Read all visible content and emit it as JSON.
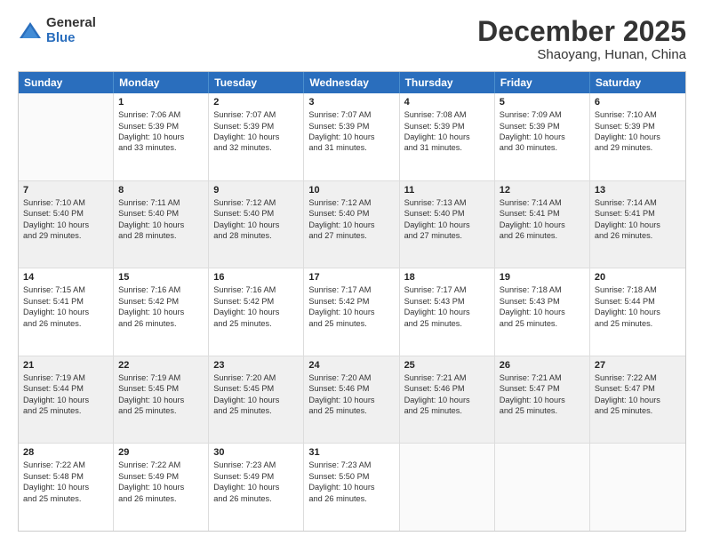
{
  "logo": {
    "general": "General",
    "blue": "Blue"
  },
  "header": {
    "month": "December 2025",
    "location": "Shaoyang, Hunan, China"
  },
  "days": [
    "Sunday",
    "Monday",
    "Tuesday",
    "Wednesday",
    "Thursday",
    "Friday",
    "Saturday"
  ],
  "rows": [
    [
      {
        "num": "",
        "lines": []
      },
      {
        "num": "1",
        "lines": [
          "Sunrise: 7:06 AM",
          "Sunset: 5:39 PM",
          "Daylight: 10 hours",
          "and 33 minutes."
        ]
      },
      {
        "num": "2",
        "lines": [
          "Sunrise: 7:07 AM",
          "Sunset: 5:39 PM",
          "Daylight: 10 hours",
          "and 32 minutes."
        ]
      },
      {
        "num": "3",
        "lines": [
          "Sunrise: 7:07 AM",
          "Sunset: 5:39 PM",
          "Daylight: 10 hours",
          "and 31 minutes."
        ]
      },
      {
        "num": "4",
        "lines": [
          "Sunrise: 7:08 AM",
          "Sunset: 5:39 PM",
          "Daylight: 10 hours",
          "and 31 minutes."
        ]
      },
      {
        "num": "5",
        "lines": [
          "Sunrise: 7:09 AM",
          "Sunset: 5:39 PM",
          "Daylight: 10 hours",
          "and 30 minutes."
        ]
      },
      {
        "num": "6",
        "lines": [
          "Sunrise: 7:10 AM",
          "Sunset: 5:39 PM",
          "Daylight: 10 hours",
          "and 29 minutes."
        ]
      }
    ],
    [
      {
        "num": "7",
        "lines": [
          "Sunrise: 7:10 AM",
          "Sunset: 5:40 PM",
          "Daylight: 10 hours",
          "and 29 minutes."
        ]
      },
      {
        "num": "8",
        "lines": [
          "Sunrise: 7:11 AM",
          "Sunset: 5:40 PM",
          "Daylight: 10 hours",
          "and 28 minutes."
        ]
      },
      {
        "num": "9",
        "lines": [
          "Sunrise: 7:12 AM",
          "Sunset: 5:40 PM",
          "Daylight: 10 hours",
          "and 28 minutes."
        ]
      },
      {
        "num": "10",
        "lines": [
          "Sunrise: 7:12 AM",
          "Sunset: 5:40 PM",
          "Daylight: 10 hours",
          "and 27 minutes."
        ]
      },
      {
        "num": "11",
        "lines": [
          "Sunrise: 7:13 AM",
          "Sunset: 5:40 PM",
          "Daylight: 10 hours",
          "and 27 minutes."
        ]
      },
      {
        "num": "12",
        "lines": [
          "Sunrise: 7:14 AM",
          "Sunset: 5:41 PM",
          "Daylight: 10 hours",
          "and 26 minutes."
        ]
      },
      {
        "num": "13",
        "lines": [
          "Sunrise: 7:14 AM",
          "Sunset: 5:41 PM",
          "Daylight: 10 hours",
          "and 26 minutes."
        ]
      }
    ],
    [
      {
        "num": "14",
        "lines": [
          "Sunrise: 7:15 AM",
          "Sunset: 5:41 PM",
          "Daylight: 10 hours",
          "and 26 minutes."
        ]
      },
      {
        "num": "15",
        "lines": [
          "Sunrise: 7:16 AM",
          "Sunset: 5:42 PM",
          "Daylight: 10 hours",
          "and 26 minutes."
        ]
      },
      {
        "num": "16",
        "lines": [
          "Sunrise: 7:16 AM",
          "Sunset: 5:42 PM",
          "Daylight: 10 hours",
          "and 25 minutes."
        ]
      },
      {
        "num": "17",
        "lines": [
          "Sunrise: 7:17 AM",
          "Sunset: 5:42 PM",
          "Daylight: 10 hours",
          "and 25 minutes."
        ]
      },
      {
        "num": "18",
        "lines": [
          "Sunrise: 7:17 AM",
          "Sunset: 5:43 PM",
          "Daylight: 10 hours",
          "and 25 minutes."
        ]
      },
      {
        "num": "19",
        "lines": [
          "Sunrise: 7:18 AM",
          "Sunset: 5:43 PM",
          "Daylight: 10 hours",
          "and 25 minutes."
        ]
      },
      {
        "num": "20",
        "lines": [
          "Sunrise: 7:18 AM",
          "Sunset: 5:44 PM",
          "Daylight: 10 hours",
          "and 25 minutes."
        ]
      }
    ],
    [
      {
        "num": "21",
        "lines": [
          "Sunrise: 7:19 AM",
          "Sunset: 5:44 PM",
          "Daylight: 10 hours",
          "and 25 minutes."
        ]
      },
      {
        "num": "22",
        "lines": [
          "Sunrise: 7:19 AM",
          "Sunset: 5:45 PM",
          "Daylight: 10 hours",
          "and 25 minutes."
        ]
      },
      {
        "num": "23",
        "lines": [
          "Sunrise: 7:20 AM",
          "Sunset: 5:45 PM",
          "Daylight: 10 hours",
          "and 25 minutes."
        ]
      },
      {
        "num": "24",
        "lines": [
          "Sunrise: 7:20 AM",
          "Sunset: 5:46 PM",
          "Daylight: 10 hours",
          "and 25 minutes."
        ]
      },
      {
        "num": "25",
        "lines": [
          "Sunrise: 7:21 AM",
          "Sunset: 5:46 PM",
          "Daylight: 10 hours",
          "and 25 minutes."
        ]
      },
      {
        "num": "26",
        "lines": [
          "Sunrise: 7:21 AM",
          "Sunset: 5:47 PM",
          "Daylight: 10 hours",
          "and 25 minutes."
        ]
      },
      {
        "num": "27",
        "lines": [
          "Sunrise: 7:22 AM",
          "Sunset: 5:47 PM",
          "Daylight: 10 hours",
          "and 25 minutes."
        ]
      }
    ],
    [
      {
        "num": "28",
        "lines": [
          "Sunrise: 7:22 AM",
          "Sunset: 5:48 PM",
          "Daylight: 10 hours",
          "and 25 minutes."
        ]
      },
      {
        "num": "29",
        "lines": [
          "Sunrise: 7:22 AM",
          "Sunset: 5:49 PM",
          "Daylight: 10 hours",
          "and 26 minutes."
        ]
      },
      {
        "num": "30",
        "lines": [
          "Sunrise: 7:23 AM",
          "Sunset: 5:49 PM",
          "Daylight: 10 hours",
          "and 26 minutes."
        ]
      },
      {
        "num": "31",
        "lines": [
          "Sunrise: 7:23 AM",
          "Sunset: 5:50 PM",
          "Daylight: 10 hours",
          "and 26 minutes."
        ]
      },
      {
        "num": "",
        "lines": []
      },
      {
        "num": "",
        "lines": []
      },
      {
        "num": "",
        "lines": []
      }
    ]
  ]
}
